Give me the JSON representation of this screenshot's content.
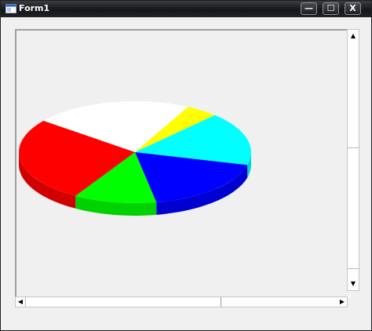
{
  "window": {
    "title": "Form1",
    "minimize_symbol": "—",
    "maximize_symbol": "☐",
    "close_symbol": "X"
  },
  "scrollbars": {
    "up_arrow": "▲",
    "down_arrow": "▼",
    "left_arrow": "◀",
    "right_arrow": "▶"
  },
  "chart_data": {
    "type": "pie",
    "style": "3d",
    "title": "",
    "slices": [
      {
        "label": "",
        "value": 22,
        "color": "#ffffff"
      },
      {
        "label": "",
        "value": 4.5,
        "color": "#ffff00"
      },
      {
        "label": "",
        "value": 17,
        "color": "#00ffff"
      },
      {
        "label": "",
        "value": 18,
        "color": "#0000ff"
      },
      {
        "label": "",
        "value": 11.5,
        "color": "#00ff00"
      },
      {
        "label": "",
        "value": 27,
        "color": "#ff0000"
      }
    ]
  }
}
